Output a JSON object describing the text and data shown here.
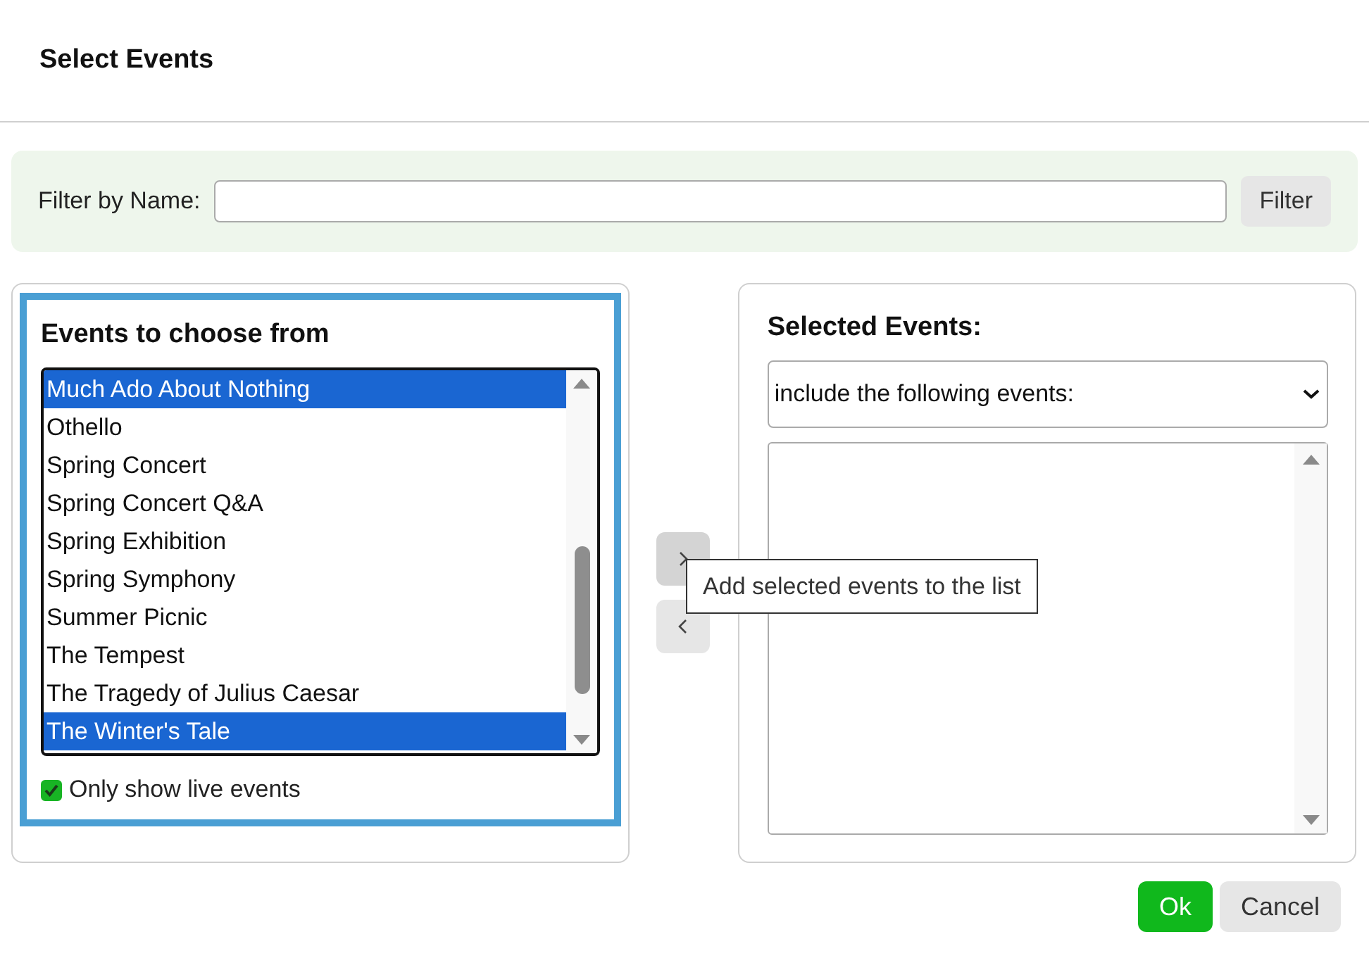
{
  "dialog": {
    "title": "Select Events"
  },
  "filter": {
    "label": "Filter by Name:",
    "button": "Filter"
  },
  "available": {
    "title": "Events to choose from",
    "focused": true,
    "items": [
      {
        "label": "Much Ado About Nothing",
        "selected": true
      },
      {
        "label": "Othello",
        "selected": false
      },
      {
        "label": "Spring Concert",
        "selected": false
      },
      {
        "label": "Spring Concert Q&A",
        "selected": false
      },
      {
        "label": "Spring Exhibition",
        "selected": false
      },
      {
        "label": "Spring Symphony",
        "selected": false
      },
      {
        "label": "Summer Picnic",
        "selected": false
      },
      {
        "label": "The Tempest",
        "selected": false
      },
      {
        "label": "The Tragedy of Julius Caesar",
        "selected": false
      },
      {
        "label": "The Winter's Tale",
        "selected": true
      }
    ],
    "live_only": {
      "label": "Only show live events",
      "checked": true
    }
  },
  "selected_events": {
    "title": "Selected Events:",
    "mode": "include the following events:"
  },
  "tooltip": {
    "text": "Add selected events to the list"
  },
  "buttons": [
    {
      "label": "Ok",
      "kind": "primary"
    },
    {
      "label": "Cancel",
      "kind": "secondary"
    }
  ]
}
